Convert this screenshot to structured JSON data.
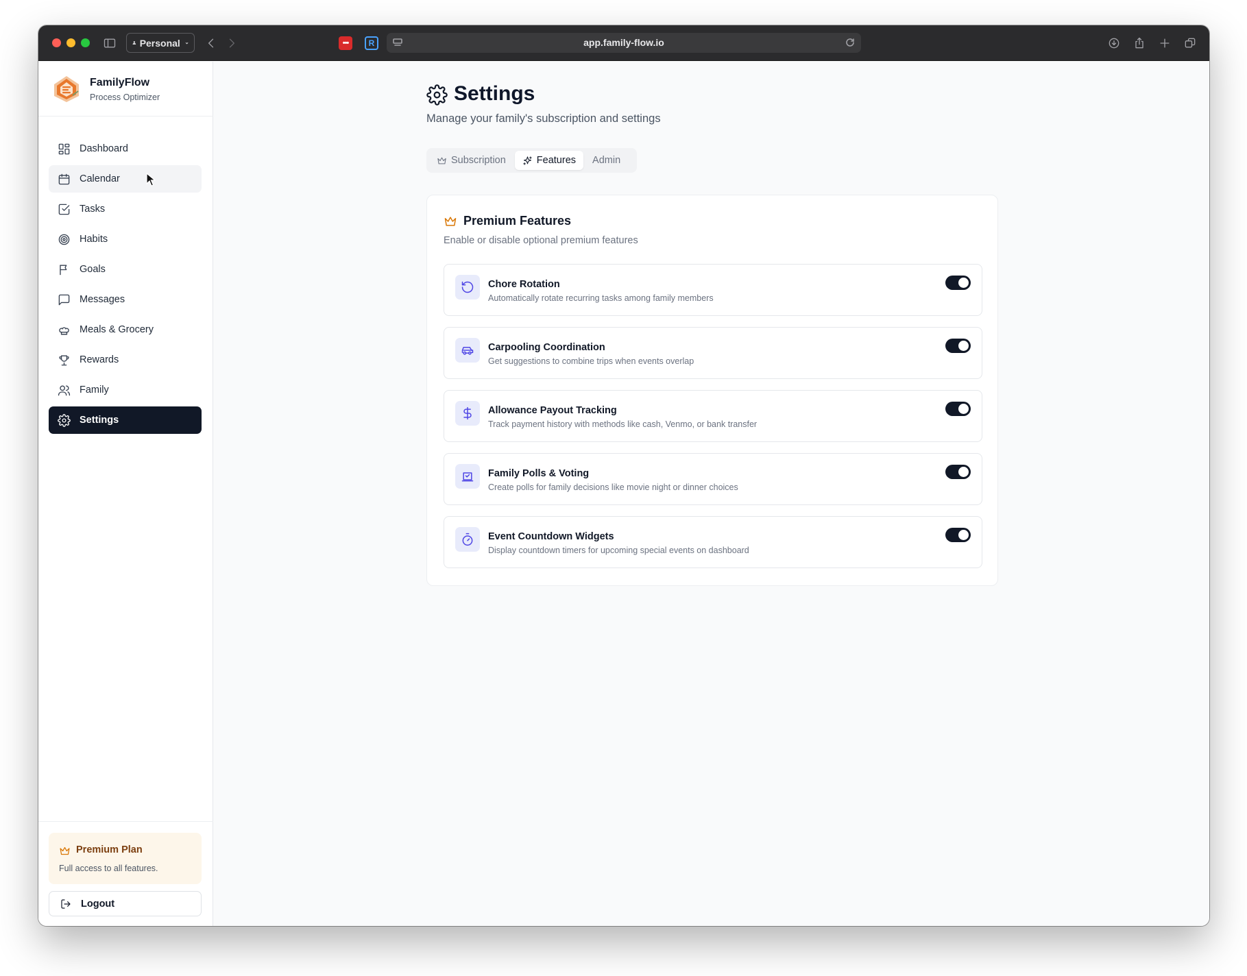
{
  "browser": {
    "profile_label": "Personal",
    "url": "app.family-flow.io",
    "ext1_label": "•••",
    "ext2_label": "R"
  },
  "brand": {
    "name": "FamilyFlow",
    "subtitle": "Process Optimizer"
  },
  "sidebar": {
    "items": [
      {
        "label": "Dashboard",
        "icon": "layout-grid-icon"
      },
      {
        "label": "Calendar",
        "icon": "calendar-icon"
      },
      {
        "label": "Tasks",
        "icon": "check-square-icon"
      },
      {
        "label": "Habits",
        "icon": "target-icon"
      },
      {
        "label": "Goals",
        "icon": "flag-icon"
      },
      {
        "label": "Messages",
        "icon": "message-square-icon"
      },
      {
        "label": "Meals & Grocery",
        "icon": "chef-hat-icon"
      },
      {
        "label": "Rewards",
        "icon": "trophy-icon"
      },
      {
        "label": "Family",
        "icon": "users-icon"
      },
      {
        "label": "Settings",
        "icon": "settings-icon"
      }
    ],
    "active": "Settings",
    "hovered": "Calendar",
    "plan": {
      "title": "Premium Plan",
      "description": "Full access to all features."
    },
    "logout_label": "Logout"
  },
  "page": {
    "title": "Settings",
    "subtitle": "Manage your family's subscription and settings",
    "tabs": [
      {
        "label": "Subscription",
        "icon": "crown-icon",
        "active": false
      },
      {
        "label": "Features",
        "icon": "sparkles-icon",
        "active": true
      },
      {
        "label": "Admin",
        "icon": "",
        "active": false
      }
    ]
  },
  "features_panel": {
    "title": "Premium Features",
    "subtitle": "Enable or disable optional premium features",
    "items": [
      {
        "title": "Chore Rotation",
        "description": "Automatically rotate recurring tasks among family members",
        "icon": "rotate-ccw-icon",
        "enabled": true
      },
      {
        "title": "Carpooling Coordination",
        "description": "Get suggestions to combine trips when events overlap",
        "icon": "car-icon",
        "enabled": true
      },
      {
        "title": "Allowance Payout Tracking",
        "description": "Track payment history with methods like cash, Venmo, or bank transfer",
        "icon": "dollar-sign-icon",
        "enabled": true
      },
      {
        "title": "Family Polls & Voting",
        "description": "Create polls for family decisions like movie night or dinner choices",
        "icon": "vote-icon",
        "enabled": true
      },
      {
        "title": "Event Countdown Widgets",
        "description": "Display countdown timers for upcoming special events on dashboard",
        "icon": "timer-icon",
        "enabled": true
      }
    ]
  },
  "colors": {
    "accent_dark": "#111827",
    "premium_amber": "#d97706",
    "feature_icon_bg": "#e8ebfb",
    "feature_icon_stroke": "#4f46e5"
  }
}
